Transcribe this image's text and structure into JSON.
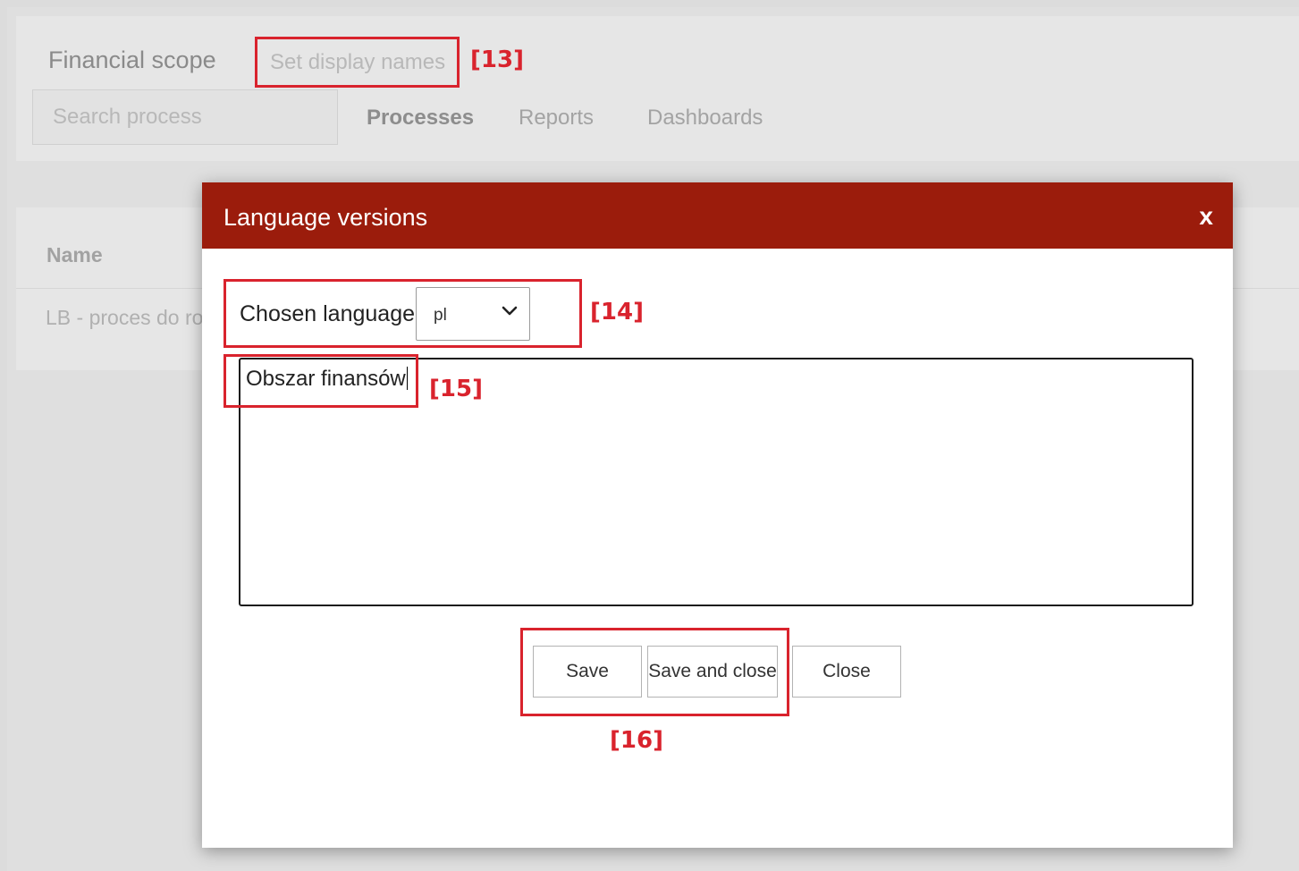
{
  "background": {
    "page_title": "Financial scope",
    "set_display_names": "Set display names",
    "search": {
      "placeholder": "Search process"
    },
    "tabs": [
      {
        "label": "Processes",
        "active": true
      },
      {
        "label": "Reports",
        "active": false
      },
      {
        "label": "Dashboards",
        "active": false
      }
    ],
    "table": {
      "column_name": "Name",
      "rows": [
        {
          "name": "LB - proces do ro"
        }
      ]
    }
  },
  "modal": {
    "title": "Language versions",
    "close_label": "x",
    "language_label": "Chosen language:",
    "language_value": "pl",
    "display_name_value": "Obszar finansów",
    "buttons": {
      "save": "Save",
      "save_and_close": "Save and close",
      "close": "Close"
    }
  },
  "annotations": {
    "a13": "[13]",
    "a14": "[14]",
    "a15": "[15]",
    "a16": "[16]"
  },
  "colors": {
    "modal_header": "#9b1c0c",
    "annotation": "#d9232d",
    "overlay_background": "#dcdcdc"
  },
  "icons": {
    "select_arrow": "chevron-down-icon",
    "modal_close": "close-icon"
  }
}
